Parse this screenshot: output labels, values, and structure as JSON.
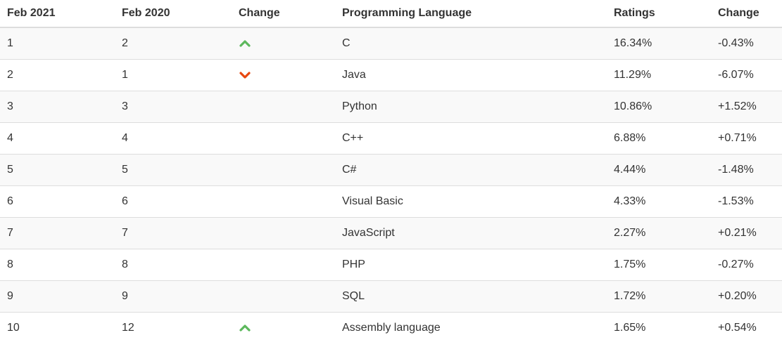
{
  "chart_data": {
    "type": "table",
    "columns": [
      "Feb 2021",
      "Feb 2020",
      "Change",
      "Programming Language",
      "Ratings",
      "Change"
    ],
    "rows": [
      {
        "rank_2021": "1",
        "rank_2020": "2",
        "trend": "up",
        "language": "C",
        "rating": "16.34%",
        "change": "-0.43%"
      },
      {
        "rank_2021": "2",
        "rank_2020": "1",
        "trend": "down",
        "language": "Java",
        "rating": "11.29%",
        "change": "-6.07%"
      },
      {
        "rank_2021": "3",
        "rank_2020": "3",
        "trend": "none",
        "language": "Python",
        "rating": "10.86%",
        "change": "+1.52%"
      },
      {
        "rank_2021": "4",
        "rank_2020": "4",
        "trend": "none",
        "language": "C++",
        "rating": "6.88%",
        "change": "+0.71%"
      },
      {
        "rank_2021": "5",
        "rank_2020": "5",
        "trend": "none",
        "language": "C#",
        "rating": "4.44%",
        "change": "-1.48%"
      },
      {
        "rank_2021": "6",
        "rank_2020": "6",
        "trend": "none",
        "language": "Visual Basic",
        "rating": "4.33%",
        "change": "-1.53%"
      },
      {
        "rank_2021": "7",
        "rank_2020": "7",
        "trend": "none",
        "language": "JavaScript",
        "rating": "2.27%",
        "change": "+0.21%"
      },
      {
        "rank_2021": "8",
        "rank_2020": "8",
        "trend": "none",
        "language": "PHP",
        "rating": "1.75%",
        "change": "-0.27%"
      },
      {
        "rank_2021": "9",
        "rank_2020": "9",
        "trend": "none",
        "language": "SQL",
        "rating": "1.72%",
        "change": "+0.20%"
      },
      {
        "rank_2021": "10",
        "rank_2020": "12",
        "trend": "up",
        "language": "Assembly language",
        "rating": "1.65%",
        "change": "+0.54%"
      }
    ]
  },
  "trend_icons": {
    "up": {
      "icon": "chevron-up-icon",
      "color": "#5cb85c"
    },
    "down": {
      "icon": "chevron-down-icon",
      "color": "#e8470f"
    }
  }
}
